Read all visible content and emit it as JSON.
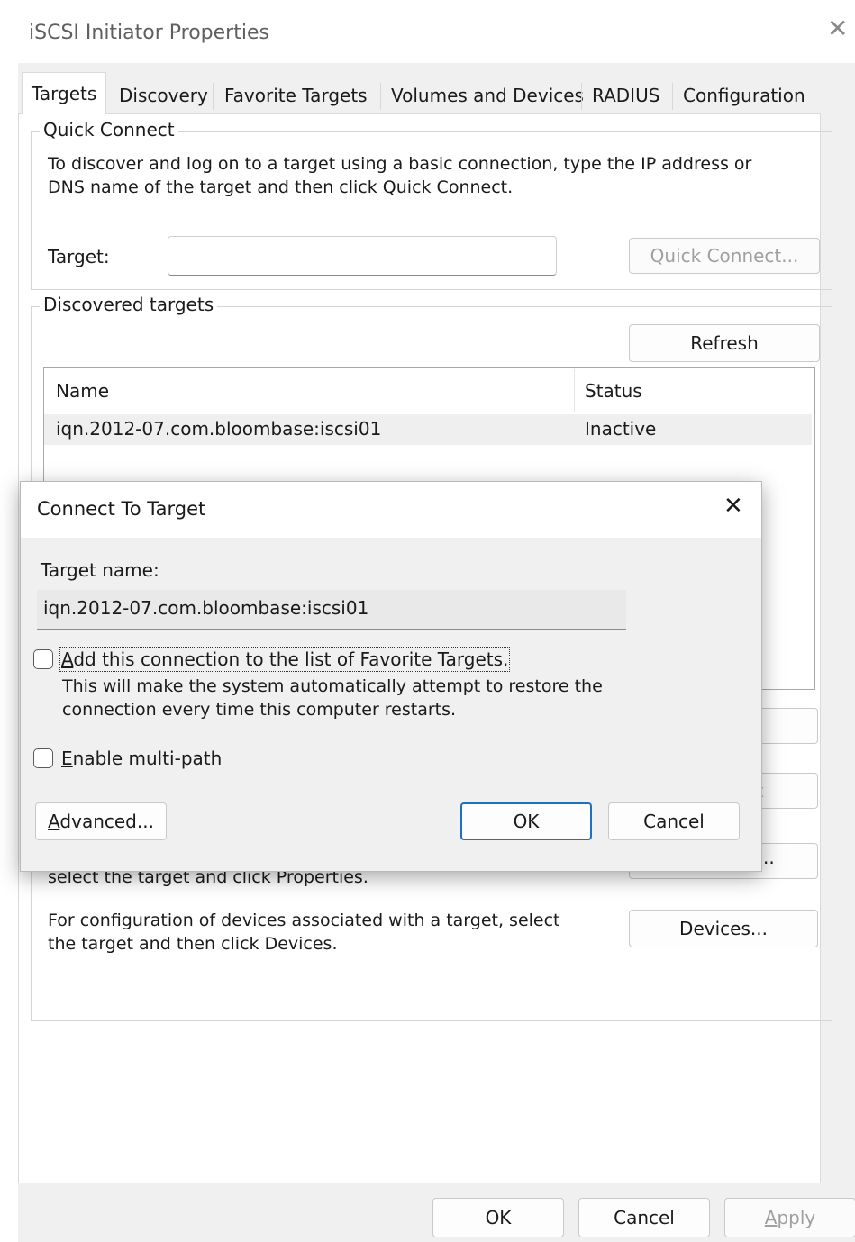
{
  "window": {
    "title": "iSCSI Initiator Properties",
    "close_glyph": "✕"
  },
  "tabs": [
    {
      "label": "Targets"
    },
    {
      "label": "Discovery"
    },
    {
      "label": "Favorite Targets"
    },
    {
      "label": "Volumes and Devices"
    },
    {
      "label": "RADIUS"
    },
    {
      "label": "Configuration"
    }
  ],
  "quick_connect": {
    "group_label": "Quick Connect",
    "description_line1": "To discover and log on to a target using a basic connection, type the IP address or",
    "description_line2": "DNS name of the target and then click Quick Connect.",
    "target_label": "Target:",
    "target_value": "",
    "button_label": "Quick Connect..."
  },
  "discovered": {
    "group_label": "Discovered targets",
    "refresh_label": "Refresh",
    "columns": [
      "Name",
      "Status"
    ],
    "rows": [
      {
        "name": "iqn.2012-07.com.bloombase:iscsi01",
        "status": "Inactive"
      }
    ],
    "partial_button_3_tail": "t",
    "partial_button_4_tail": "..",
    "properties_line2": "select the target and click Properties.",
    "devices_line1": "For configuration of devices associated with a target, select",
    "devices_line2": "the target and then click Devices.",
    "devices_button_label": "Devices..."
  },
  "dialog": {
    "title": "Connect To Target",
    "close_glyph": "✕",
    "target_name_label": "Target name:",
    "target_name_value": "iqn.2012-07.com.bloombase:iscsi01",
    "favorite_checkbox": {
      "label_underlined": "A",
      "label_rest": "dd this connection to the list of Favorite Targets.",
      "checked": false
    },
    "favorite_help_line1": "This will make the system automatically attempt to restore the",
    "favorite_help_line2": "connection every time this computer restarts.",
    "multipath_checkbox": {
      "label_underlined": "E",
      "label_rest": "nable multi-path",
      "checked": false
    },
    "advanced_underlined": "A",
    "advanced_rest": "dvanced...",
    "ok_label": "OK",
    "cancel_label": "Cancel"
  },
  "footer": {
    "ok_label": "OK",
    "cancel_label": "Cancel",
    "apply_underlined": "A",
    "apply_rest": "pply"
  }
}
